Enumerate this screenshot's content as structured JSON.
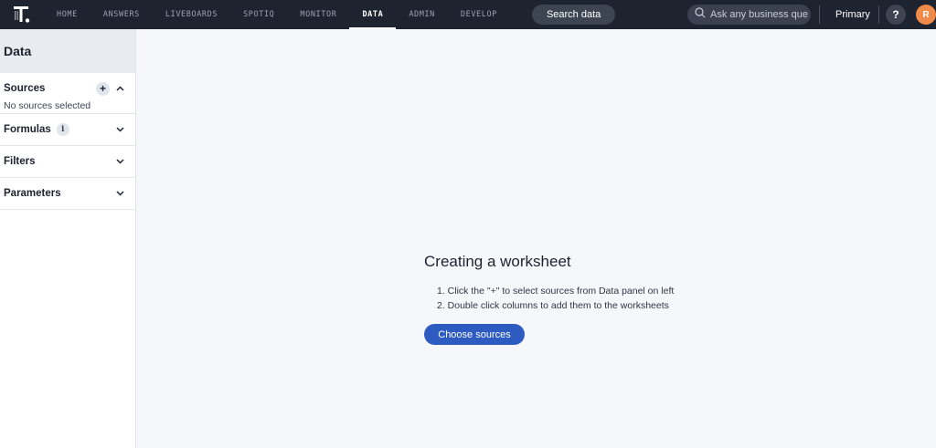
{
  "topbar": {
    "logo_icon": "thoughtspot-logo-icon",
    "nav_items": [
      "HOME",
      "ANSWERS",
      "LIVEBOARDS",
      "SPOTIQ",
      "MONITOR",
      "DATA",
      "ADMIN",
      "DEVELOP"
    ],
    "active_nav": "DATA",
    "search_data_label": "Search data",
    "ask_placeholder": "Ask any business que...",
    "org_label": "Primary",
    "help_label": "?",
    "avatar_initial": "R",
    "avatar_color": "#f08a4b",
    "bar_color": "#1d232f"
  },
  "left_panel": {
    "title": "Data",
    "sections": [
      {
        "label": "Sources",
        "body": "No sources selected",
        "expanded": true
      },
      {
        "label": "Formulas",
        "info": "i",
        "expanded": false
      },
      {
        "label": "Filters",
        "expanded": false
      },
      {
        "label": "Parameters",
        "expanded": false
      }
    ]
  },
  "main": {
    "title": "Creating a worksheet",
    "steps": [
      "1. Click the \"+\" to select sources from Data panel on left",
      "2. Double click columns to add them to the worksheets"
    ],
    "choose_sources_label": "Choose sources",
    "accent_color": "#2d5bc0"
  }
}
